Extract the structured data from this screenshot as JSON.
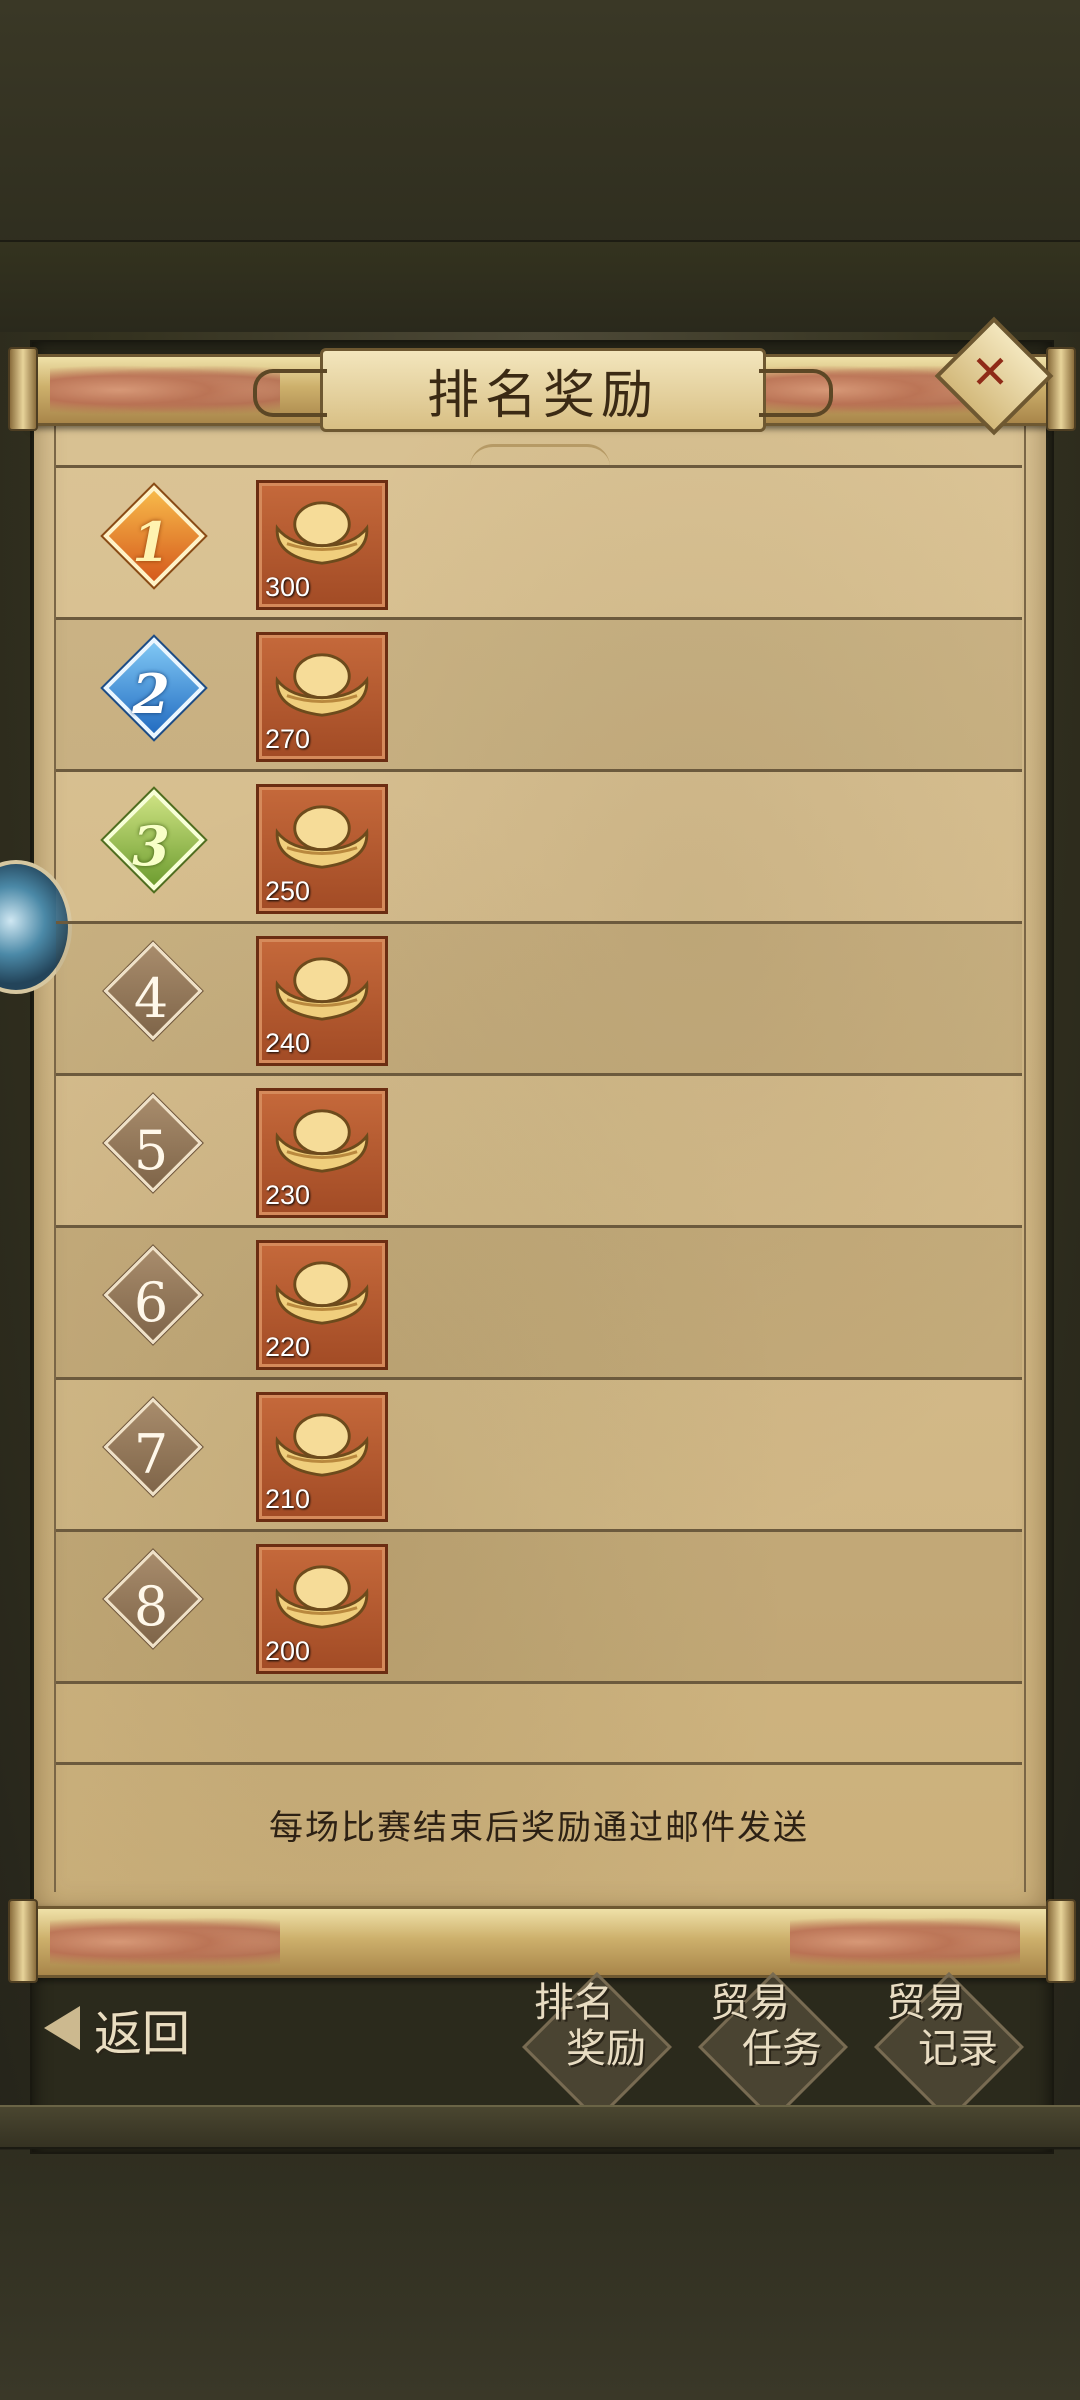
{
  "header": {
    "title": "排名奖励",
    "close_label": "✕"
  },
  "rewards": [
    {
      "rank": "1",
      "amount": "300",
      "item": "gold-ingot"
    },
    {
      "rank": "2",
      "amount": "270",
      "item": "gold-ingot"
    },
    {
      "rank": "3",
      "amount": "250",
      "item": "gold-ingot"
    },
    {
      "rank": "4",
      "amount": "240",
      "item": "gold-ingot"
    },
    {
      "rank": "5",
      "amount": "230",
      "item": "gold-ingot"
    },
    {
      "rank": "6",
      "amount": "220",
      "item": "gold-ingot"
    },
    {
      "rank": "7",
      "amount": "210",
      "item": "gold-ingot"
    },
    {
      "rank": "8",
      "amount": "200",
      "item": "gold-ingot"
    }
  ],
  "footer_note": "每场比赛结束后奖励通过邮件发送",
  "bottom_nav": {
    "back_label": "返回",
    "tabs": [
      {
        "line1": "排名",
        "line2": "奖励"
      },
      {
        "line1": "贸易",
        "line2": "任务"
      },
      {
        "line1": "贸易",
        "line2": "记录"
      }
    ]
  },
  "colors": {
    "paper": "#d9c293",
    "frame": "#2b2a1c",
    "item_bg": "#c5693b",
    "rank1": "#f7b94a",
    "rank2": "#236cc1",
    "rank3": "#6e9d30"
  }
}
